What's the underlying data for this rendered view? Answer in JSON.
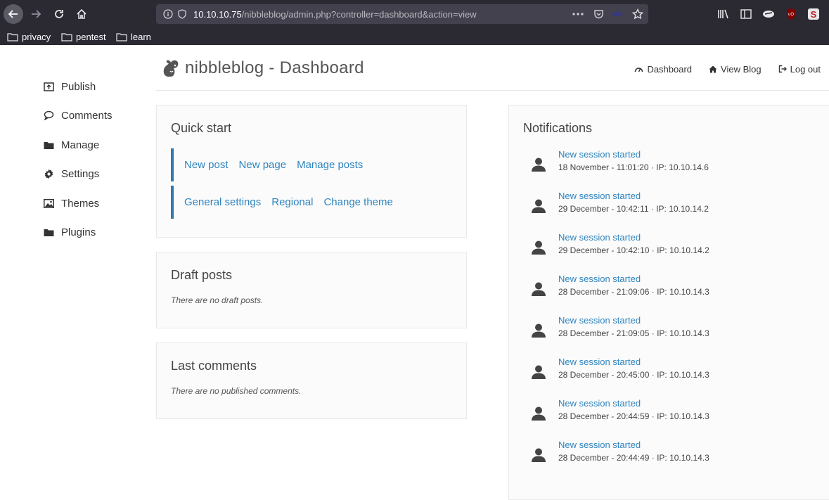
{
  "browser": {
    "url_host": "10.10.10.75",
    "url_path": "/nibbleblog/admin.php?controller=dashboard&action=view",
    "bookmarks": [
      "privacy",
      "pentest",
      "learn"
    ]
  },
  "brand": {
    "title": "nibbleblog - Dashboard",
    "logo_icon": "squirrel-icon"
  },
  "topnav": [
    {
      "label": "Dashboard",
      "icon": "dashboard-gauge-icon"
    },
    {
      "label": "View Blog",
      "icon": "home-icon"
    },
    {
      "label": "Log out",
      "icon": "logout-icon"
    }
  ],
  "sidebar": [
    {
      "label": "Publish",
      "icon": "publish-icon"
    },
    {
      "label": "Comments",
      "icon": "comment-icon"
    },
    {
      "label": "Manage",
      "icon": "folder-icon"
    },
    {
      "label": "Settings",
      "icon": "gear-icon"
    },
    {
      "label": "Themes",
      "icon": "image-icon"
    },
    {
      "label": "Plugins",
      "icon": "folder-icon"
    }
  ],
  "quick_start": {
    "title": "Quick start",
    "row1": [
      "New post",
      "New page",
      "Manage posts"
    ],
    "row2": [
      "General settings",
      "Regional",
      "Change theme"
    ]
  },
  "draft_posts": {
    "title": "Draft posts",
    "empty": "There are no draft posts."
  },
  "last_comments": {
    "title": "Last comments",
    "empty": "There are no published comments."
  },
  "notifications": {
    "title": "Notifications",
    "items": [
      {
        "title": "New session started",
        "meta": "18 November - 11:01:20 · IP: 10.10.14.6"
      },
      {
        "title": "New session started",
        "meta": "29 December - 10:42:11 · IP: 10.10.14.2"
      },
      {
        "title": "New session started",
        "meta": "29 December - 10:42:10 · IP: 10.10.14.2"
      },
      {
        "title": "New session started",
        "meta": "28 December - 21:09:06 · IP: 10.10.14.3"
      },
      {
        "title": "New session started",
        "meta": "28 December - 21:09:05 · IP: 10.10.14.3"
      },
      {
        "title": "New session started",
        "meta": "28 December - 20:45:00 · IP: 10.10.14.3"
      },
      {
        "title": "New session started",
        "meta": "28 December - 20:44:59 · IP: 10.10.14.3"
      },
      {
        "title": "New session started",
        "meta": "28 December - 20:44:49 · IP: 10.10.14.3"
      }
    ]
  },
  "colors": {
    "link": "#2e84bf",
    "accent_bar": "#2e7ab1",
    "chrome_bg": "#2b2a33"
  }
}
